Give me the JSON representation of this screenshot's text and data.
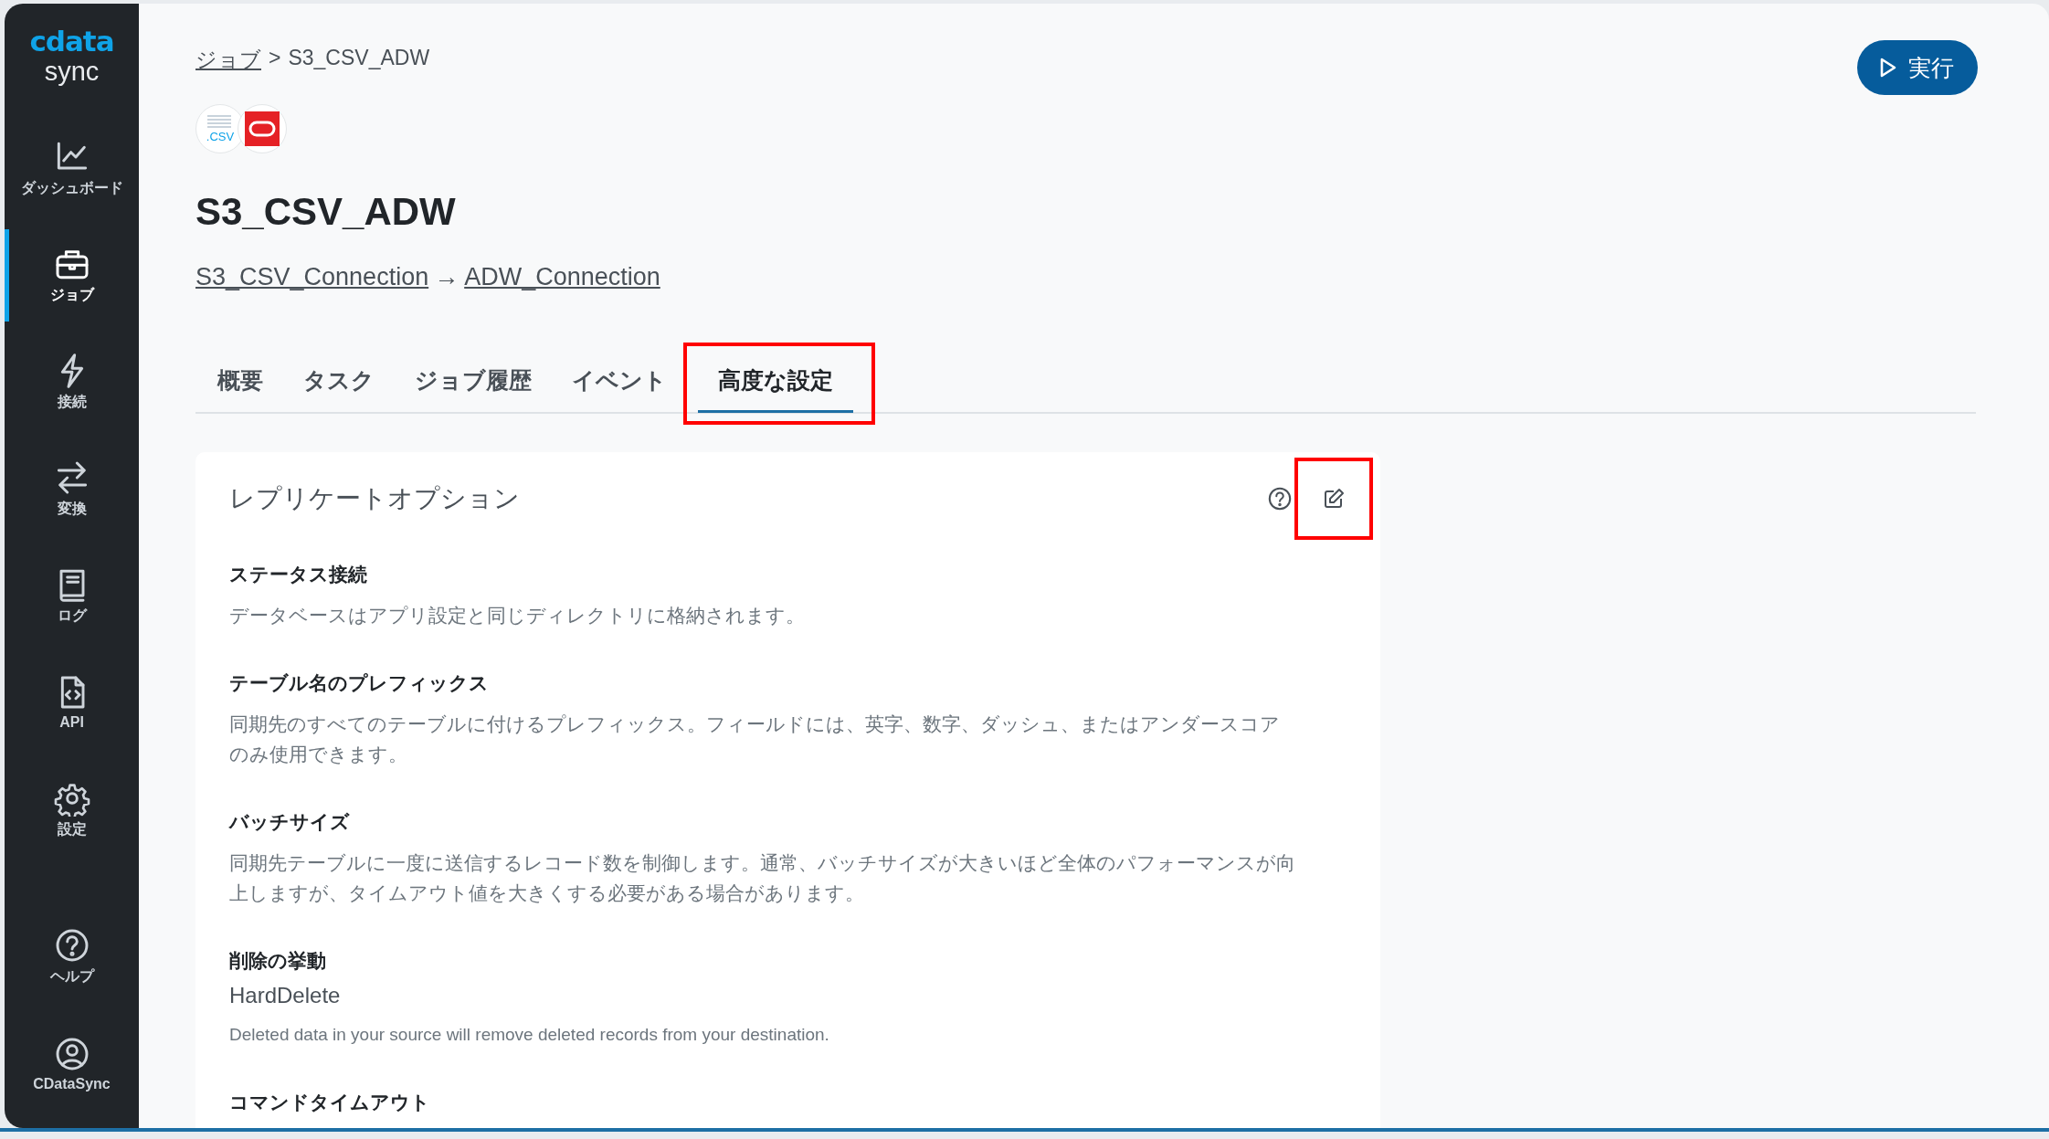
{
  "sidebar": {
    "logo": {
      "brand": "cdata",
      "product": "sync"
    },
    "items": [
      {
        "label": "ダッシュボード",
        "kind": "dashboard",
        "selected": false
      },
      {
        "label": "ジョブ",
        "kind": "job",
        "selected": true
      },
      {
        "label": "接続",
        "kind": "connection",
        "selected": false
      },
      {
        "label": "変換",
        "kind": "transform",
        "selected": false
      },
      {
        "label": "ログ",
        "kind": "log",
        "selected": false
      },
      {
        "label": "API",
        "kind": "api",
        "selected": false
      },
      {
        "label": "設定",
        "kind": "settings",
        "selected": false
      }
    ],
    "bottom_items": [
      {
        "label": "ヘルプ",
        "kind": "help",
        "selected": false
      },
      {
        "label": "CDataSync",
        "kind": "user",
        "selected": false
      }
    ]
  },
  "breadcrumb": {
    "parent": "ジョブ",
    "separator": ">",
    "current": "S3_CSV_ADW"
  },
  "run_button": {
    "label": "実行"
  },
  "job": {
    "source_icon_text": ".CSV",
    "title": "S3_CSV_ADW",
    "source": "S3_CSV_Connection",
    "arrow": "→",
    "destination": "ADW_Connection"
  },
  "tabs": [
    {
      "label": "概要",
      "selected": false,
      "highlighted": false
    },
    {
      "label": "タスク",
      "selected": false,
      "highlighted": false
    },
    {
      "label": "ジョブ履歴",
      "selected": false,
      "highlighted": false
    },
    {
      "label": "イベント",
      "selected": false,
      "highlighted": false
    },
    {
      "label": "高度な設定",
      "selected": true,
      "highlighted": true
    }
  ],
  "card": {
    "title": "レプリケートオプション",
    "edit_highlighted": true,
    "sections": [
      {
        "heading": "ステータス接続",
        "description": "データベースはアプリ設定と同じディレクトリに格納されます。"
      },
      {
        "heading": "テーブル名のプレフィックス",
        "description": "同期先のすべてのテーブルに付けるプレフィックス。フィールドには、英字、数字、ダッシュ、またはアンダースコアのみ使用できます。"
      },
      {
        "heading": "バッチサイズ",
        "description": "同期先テーブルに一度に送信するレコード数を制御します。通常、バッチサイズが大きいほど全体のパフォーマンスが向上しますが、タイムアウト値を大きくする必要がある場合があります。"
      },
      {
        "heading": "削除の挙動",
        "value": "HardDelete",
        "description": "Deleted data in your source will remove deleted records from your destination."
      },
      {
        "heading": "コマンドタイムアウト"
      }
    ]
  }
}
